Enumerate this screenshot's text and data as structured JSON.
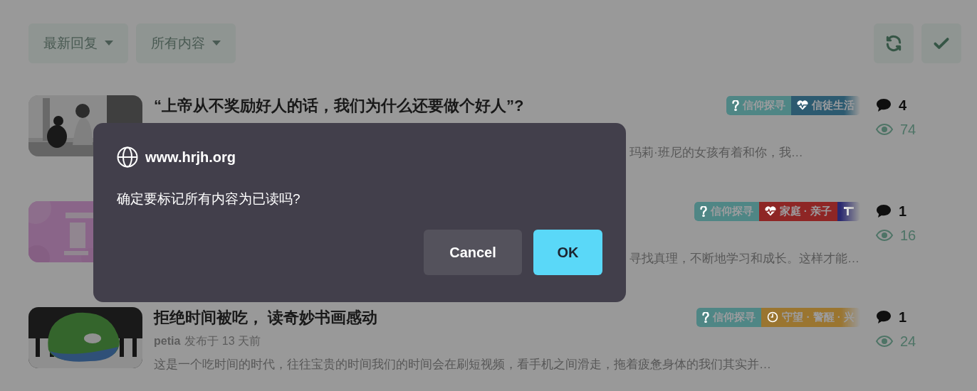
{
  "toolbar": {
    "filters": [
      {
        "label": "最新回复"
      },
      {
        "label": "所有内容"
      }
    ],
    "actions": [
      {
        "kind": "refresh"
      },
      {
        "kind": "check"
      }
    ]
  },
  "topics": [
    {
      "thumbnail": {
        "kind": "picture"
      },
      "title": "“上帝从不奖励好人的话，我们为什么还要做个好人”?",
      "excerpt": "玛莉·班尼的女孩有着和你，我…",
      "tags": [
        {
          "label": "信仰探寻",
          "kind": "question",
          "color": "#4f8685"
        },
        {
          "label": "信徒生活",
          "kind": "heartbeat",
          "color": "#2c5a70"
        }
      ],
      "replies": "4",
      "views": "74"
    },
    {
      "thumbnail": {
        "kind": "picture"
      },
      "excerpt": "寻找真理，不断地学习和成长。这样才能…",
      "tags": [
        {
          "label": "信仰探寻",
          "kind": "question",
          "color": "#4f8685"
        },
        {
          "label": "家庭 · 亲子",
          "kind": "heartbeat",
          "color": "#8e2625"
        },
        {
          "kind": "block",
          "color": "#2a2870"
        }
      ],
      "replies": "1",
      "views": "16"
    },
    {
      "thumbnail": {
        "kind": "picture"
      },
      "title": "拒绝时间被吃， 读奇妙书画感动",
      "author": "petia",
      "posted": "发布于 13 天前",
      "excerpt": "这是一个吃时间的时代，往往宝贵的时间我们的时间会在刷短视频，看手机之间滑走，拖着疲惫身体的我们其实并…",
      "tags": [
        {
          "label": "信仰探寻",
          "kind": "question",
          "color": "#4f8685"
        },
        {
          "label": "守望 · 警醒 · 兴",
          "kind": "clock",
          "color": "#9a7530"
        }
      ],
      "replies": "1",
      "views": "24"
    }
  ],
  "dialog": {
    "host": "www.hrjh.org",
    "message": "确定要标记所有内容为已读吗?",
    "buttons": [
      {
        "label": "Cancel",
        "kind": "secondary"
      },
      {
        "label": "OK",
        "kind": "primary"
      }
    ]
  }
}
